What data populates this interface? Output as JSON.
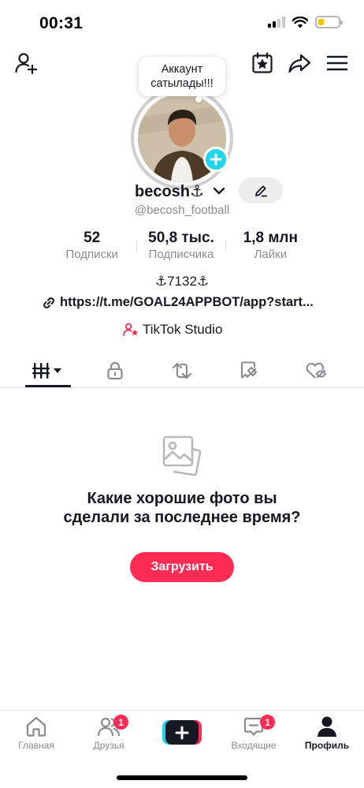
{
  "status_bar": {
    "time": "00:31",
    "battery_level": 0.3
  },
  "header": {
    "add_friend_icon": "person-add-icon",
    "calendar_icon": "calendar-star-icon",
    "share_icon": "share-arrow-icon",
    "menu_icon": "hamburger-menu-icon"
  },
  "profile": {
    "bubble_text": "Аккаунт сатылады!!!",
    "display_name": "becosh⚓",
    "handle": "@becosh_football",
    "bio": "⚓7132⚓",
    "link": "https://t.me/GOAL24APPBOT/app?start...",
    "studio_label": "TikTok Studio"
  },
  "stats": [
    {
      "value": "52",
      "label": "Подписки"
    },
    {
      "value": "50,8 тыс.",
      "label": "Подписчика"
    },
    {
      "value": "1,8 млн",
      "label": "Лайки"
    }
  ],
  "tabs": [
    {
      "icon": "grid-videos-icon",
      "active": true
    },
    {
      "icon": "lock-icon",
      "active": false
    },
    {
      "icon": "repost-icon",
      "active": false
    },
    {
      "icon": "saved-tag-icon",
      "active": false
    },
    {
      "icon": "liked-hidden-icon",
      "active": false
    }
  ],
  "empty_state": {
    "icon": "photos-icon",
    "title": "Какие хорошие фото вы сделали за последнее время?",
    "button_label": "Загрузить"
  },
  "bottom_nav": {
    "home": {
      "label": "Главная"
    },
    "friends": {
      "label": "Друзья",
      "badge": "1"
    },
    "inbox": {
      "label": "Входящие",
      "badge": "1"
    },
    "profile": {
      "label": "Профиль"
    }
  },
  "colors": {
    "accent": "#fe2c55",
    "cyan": "#20d5ec",
    "text": "#161823",
    "secondary": "#8a8b91"
  }
}
